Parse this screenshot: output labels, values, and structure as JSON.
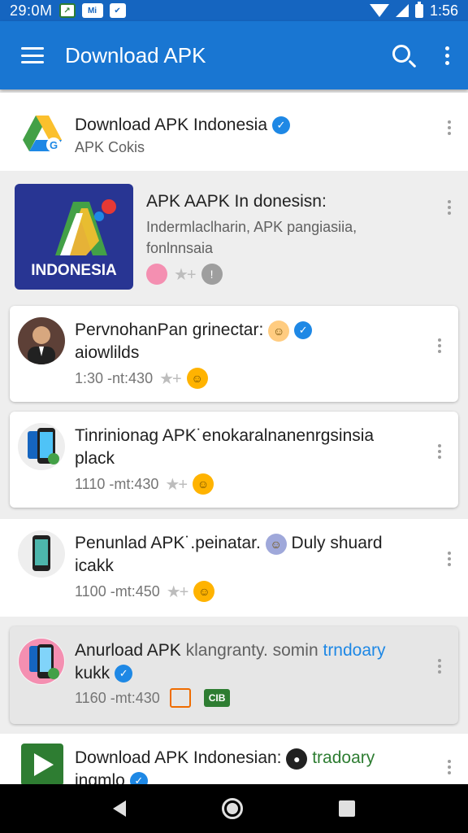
{
  "status_bar": {
    "time_left": "29:0M",
    "mi_label": "Mi",
    "time_right": "1:56"
  },
  "app_bar": {
    "title": "Download APK"
  },
  "items": [
    {
      "title": "Download APK Indonesia",
      "subtitle": "APK Cokis"
    },
    {
      "title": "APK AAPK In donesisn:",
      "subtitle_line1": "Indermlaclharin, APK pangiasiia,",
      "subtitle_line2": "fonlnnsaia",
      "logo_text": "INDONESIA"
    },
    {
      "title_line1": "PervnohanPan grinectar:",
      "title_line2": "aiowlilds",
      "meta": "1:30 -nt:430"
    },
    {
      "title_line1": "Tinrinionag APK˙enokaralnanenrgsinsia",
      "title_line2": "plack",
      "meta": "1110 -mt:430"
    },
    {
      "title_line1_a": "Penunlad APK˙.peinatar.",
      "title_line1_b": "Duly shuard",
      "title_line2": "icakk",
      "meta": "1100 -mt:450"
    },
    {
      "title_line1_a": "Anurload APK",
      "title_line1_b": "klangranty. somin",
      "tag": "trndoary",
      "title_line2": "kukk",
      "meta": "1160 -mt:430",
      "badge_text": "CIB"
    },
    {
      "title_line1": "Download APK Indonesian:",
      "tag": "tradoary",
      "title_line2": "ingmlo"
    }
  ],
  "colors": {
    "status_bar": "#1565c0",
    "app_bar": "#1976d2",
    "verified": "#1e88e5",
    "tag_blue": "#1e88e5",
    "tag_green": "#2e7d32"
  },
  "icons": [
    "menu-icon",
    "search-icon",
    "more-vert-icon",
    "verified-icon",
    "back-icon",
    "home-icon",
    "recents-icon"
  ]
}
